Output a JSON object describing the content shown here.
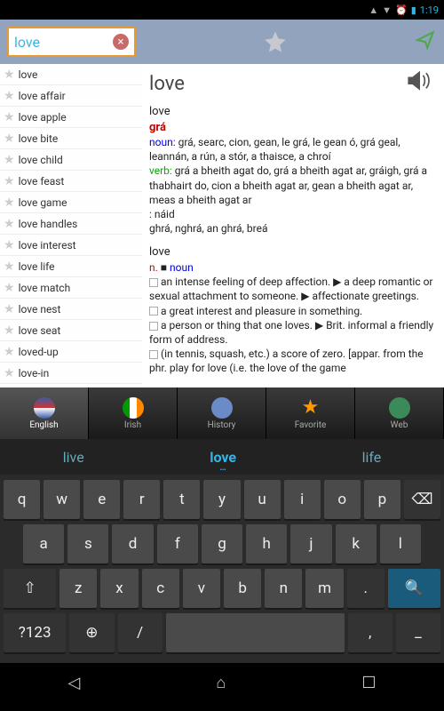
{
  "statusbar": {
    "time": "1:19",
    "alarm": "⏰",
    "battery": "▮"
  },
  "search": {
    "value": "love"
  },
  "sidebar": [
    "love",
    "love affair",
    "love apple",
    "love bite",
    "love child",
    "love feast",
    "love game",
    "love handles",
    "love interest",
    "love life",
    "love match",
    "love nest",
    "love seat",
    "loved-up",
    "love-in"
  ],
  "detail": {
    "headword": "love",
    "word1": "love",
    "translation": "grá",
    "noun_label": "noun:",
    "noun_text": "grá, searc, cion, gean, le grá, le gean ó, grá geal, leannán, a rún, a stór, a thaisce, a chroí",
    "verb_label": "verb:",
    "verb_text": "grá a bheith agat do, grá a bheith agat ar, gráigh, grá a thabhairt do, cion a bheith agat ar, gean a bheith agat ar, meas a bheith agat ar",
    "colon_line": ": náid",
    "forms": "ghrá, nghrá, an ghrá, breá",
    "word2": "love",
    "pos2": "n. ■ noun",
    "def1": "an intense feeling of deep affection. ▶ a deep romantic or sexual attachment to someone. ▶ affectionate greetings.",
    "def2": "a great interest and pleasure in something.",
    "def3": "a person or thing that one loves. ▶ Brit. informal a friendly form of address.",
    "def4": "(in tennis, squash, etc.) a score of zero. [appar. from the phr. play for love (i.e. the love of the game"
  },
  "tabs": [
    {
      "label": "English",
      "icon": "uk"
    },
    {
      "label": "Irish",
      "icon": "ie"
    },
    {
      "label": "History",
      "icon": "clock"
    },
    {
      "label": "Favorite",
      "icon": "star"
    },
    {
      "label": "Web",
      "icon": "globe"
    }
  ],
  "suggestions": [
    "live",
    "love",
    "life"
  ],
  "keyboard": {
    "row1": [
      "q",
      "w",
      "e",
      "r",
      "t",
      "y",
      "u",
      "i",
      "o",
      "p"
    ],
    "row2": [
      "a",
      "s",
      "d",
      "f",
      "g",
      "h",
      "j",
      "k",
      "l"
    ],
    "row3": [
      "z",
      "x",
      "c",
      "v",
      "b",
      "n",
      "m"
    ],
    "shift": "⇧",
    "del": "⌫",
    "num": "?123",
    "globe": "⊕",
    "slash": "/",
    "space": "",
    "search": "🔍"
  }
}
